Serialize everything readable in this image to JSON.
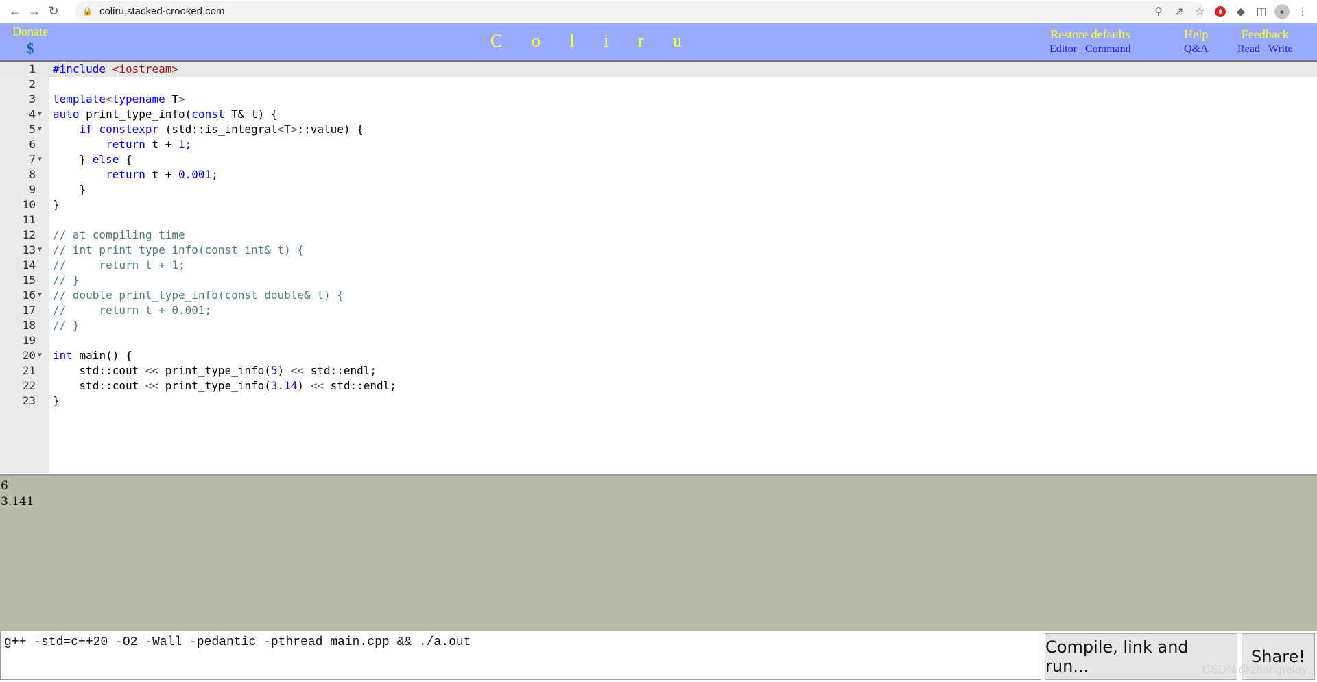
{
  "browser": {
    "url": "coliru.stacked-crooked.com"
  },
  "header": {
    "donate_label": "Donate",
    "donate_symbol": "$",
    "logo": "C o l i r u",
    "restore_defaults": "Restore defaults",
    "restore_editor": "Editor",
    "restore_command": "Command",
    "help": "Help",
    "help_qa": "Q&A",
    "feedback": "Feedback",
    "feedback_read": "Read",
    "feedback_write": "Write"
  },
  "editor": {
    "lines": [
      "#include <iostream>",
      "",
      "template<typename T>",
      "auto print_type_info(const T& t) {",
      "    if constexpr (std::is_integral<T>::value) {",
      "        return t + 1;",
      "    } else {",
      "        return t + 0.001;",
      "    }",
      "}",
      "",
      "// at compiling time",
      "// int print_type_info(const int& t) {",
      "//     return t + 1;",
      "// }",
      "// double print_type_info(const double& t) {",
      "//     return t + 0.001;",
      "// }",
      "",
      "int main() {",
      "    std::cout << print_type_info(5) << std::endl;",
      "    std::cout << print_type_info(3.14) << std::endl;",
      "}"
    ],
    "fold_lines": [
      4,
      5,
      7,
      13,
      16,
      20
    ],
    "active_line": 1
  },
  "output": {
    "lines": [
      "6",
      "3.141"
    ]
  },
  "command": {
    "value": "g++ -std=c++20 -O2 -Wall -pedantic -pthread main.cpp && ./a.out",
    "compile_label": "Compile, link and run...",
    "share_label": "Share!"
  },
  "watermark": "CSDN @zhangrelay"
}
